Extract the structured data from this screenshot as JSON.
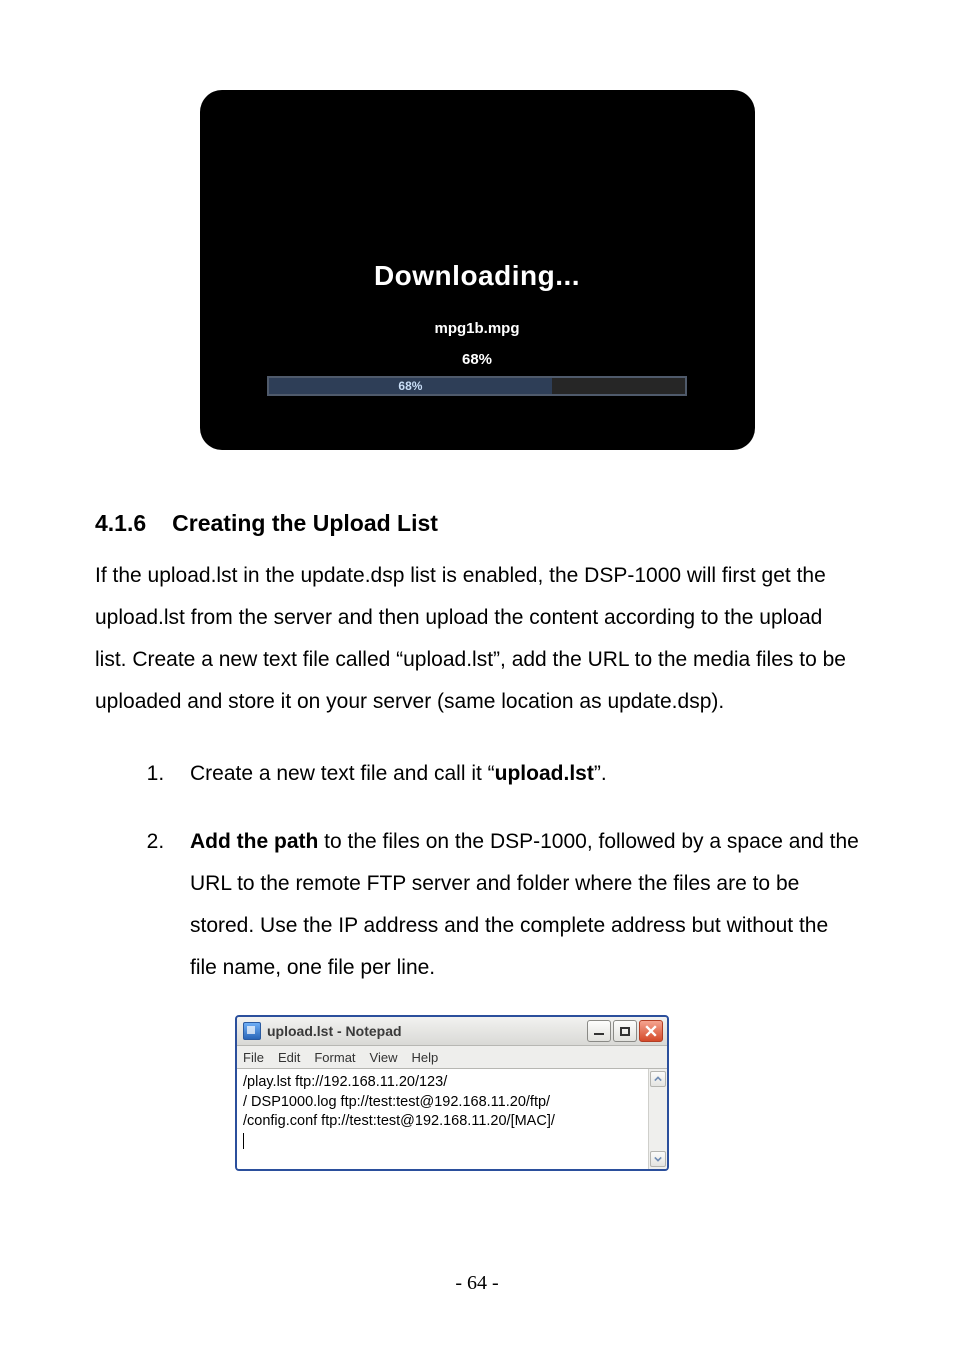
{
  "download_screen": {
    "title": "Downloading...",
    "filename": "mpg1b.mpg",
    "percent_text": "68%",
    "bar_percent_text": "68%",
    "bar_percent_value": 68
  },
  "section": {
    "number": "4.1.6",
    "title": "Creating the Upload List",
    "paragraph": "If the upload.lst in the update.dsp list is enabled, the DSP-1000 will first get the upload.lst from the server and then upload the content according to the upload list. Create a new text file called “upload.lst”, add the URL to the media files to be uploaded and store it on your server (same location as update.dsp)."
  },
  "steps": {
    "one_pre": "Create a new text file and call it “",
    "one_bold": "upload.lst",
    "one_post": "”.",
    "two_bold": "Add the path",
    "two_rest": " to the files on the DSP-1000, followed by a space and the URL to the remote FTP server and folder where the files are to be stored. Use the IP address and the complete address but without the file name, one file per line."
  },
  "notepad": {
    "title": "upload.lst - Notepad",
    "menus": [
      "File",
      "Edit",
      "Format",
      "View",
      "Help"
    ],
    "lines": [
      "/play.lst ftp://192.168.11.20/123/",
      "/ DSP1000.log ftp://test:test@192.168.11.20/ftp/",
      "/config.conf ftp://test:test@192.168.11.20/[MAC]/"
    ]
  },
  "page_number": "- 64 -"
}
